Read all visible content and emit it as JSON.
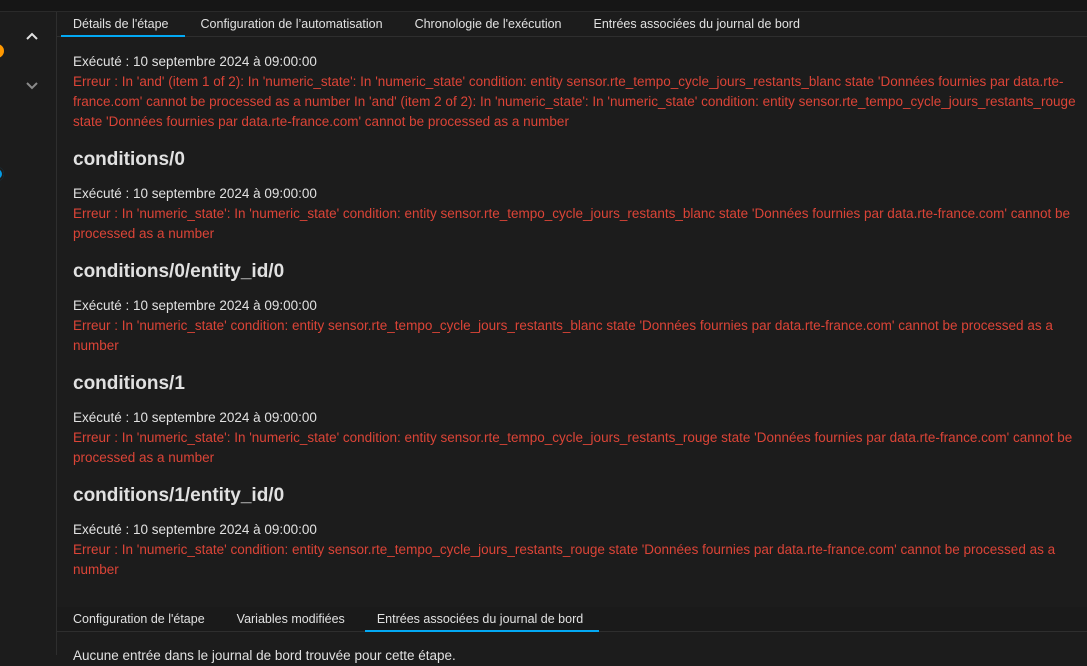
{
  "tabs_top": [
    {
      "label": "Détails de l'étape",
      "active": true
    },
    {
      "label": "Configuration de l’automatisation",
      "active": false
    },
    {
      "label": "Chronologie de l'exécution",
      "active": false
    },
    {
      "label": "Entrées associées du journal de bord",
      "active": false
    }
  ],
  "details": {
    "first": {
      "executed": "Exécuté : 10 septembre 2024 à 09:00:00",
      "error": "Erreur : In 'and' (item 1 of 2): In 'numeric_state': In 'numeric_state' condition: entity sensor.rte_tempo_cycle_jours_restants_blanc state 'Données fournies par data.rte-france.com' cannot be processed as a number In 'and' (item 2 of 2): In 'numeric_state': In 'numeric_state' condition: entity sensor.rte_tempo_cycle_jours_restants_rouge state 'Données fournies par data.rte-france.com' cannot be processed as a number"
    },
    "sections": [
      {
        "title": "conditions/0",
        "executed": "Exécuté : 10 septembre 2024 à 09:00:00",
        "error": "Erreur : In 'numeric_state': In 'numeric_state' condition: entity sensor.rte_tempo_cycle_jours_restants_blanc state 'Données fournies par data.rte-france.com' cannot be processed as a number"
      },
      {
        "title": "conditions/0/entity_id/0",
        "executed": "Exécuté : 10 septembre 2024 à 09:00:00",
        "error": "Erreur : In 'numeric_state' condition: entity sensor.rte_tempo_cycle_jours_restants_blanc state 'Données fournies par data.rte-france.com' cannot be processed as a number"
      },
      {
        "title": "conditions/1",
        "executed": "Exécuté : 10 septembre 2024 à 09:00:00",
        "error": "Erreur : In 'numeric_state': In 'numeric_state' condition: entity sensor.rte_tempo_cycle_jours_restants_rouge state 'Données fournies par data.rte-france.com' cannot be processed as a number"
      },
      {
        "title": "conditions/1/entity_id/0",
        "executed": "Exécuté : 10 septembre 2024 à 09:00:00",
        "error": "Erreur : In 'numeric_state' condition: entity sensor.rte_tempo_cycle_jours_restants_rouge state 'Données fournies par data.rte-france.com' cannot be processed as a number"
      }
    ]
  },
  "tabs_bottom": [
    {
      "label": "Configuration de l'étape",
      "active": false
    },
    {
      "label": "Variables modifiées",
      "active": false
    },
    {
      "label": "Entrées associées du journal de bord",
      "active": true
    }
  ],
  "bottom_message": "Aucune entrée dans le journal de bord trouvée pour cette étape.",
  "icons": {
    "collapse": "chevron-up-icon",
    "expand": "chevron-down-icon"
  },
  "colors": {
    "accent": "#03a9f4",
    "error": "#db4437",
    "trace_orange": "#ff9800",
    "trace_blue": "#039be5"
  }
}
